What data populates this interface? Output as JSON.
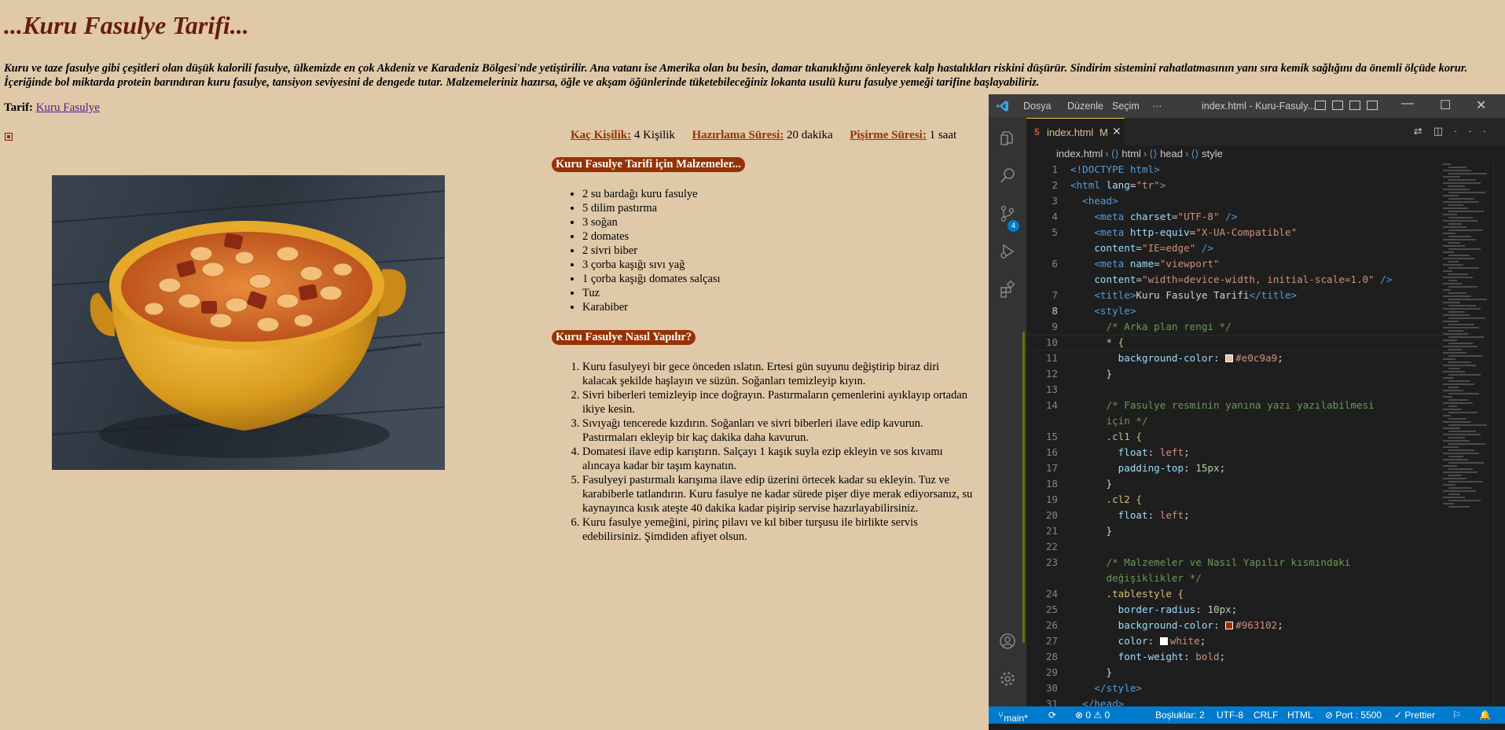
{
  "page": {
    "title": "...Kuru Fasulye Tarifi...",
    "intro": "Kuru ve taze fasulye gibi çeşitleri olan düşük kalorili fasulye, ülkemizde en çok Akdeniz ve Karadeniz Bölgesi'nde yetiştirilir. Ana vatanı ise Amerika olan bu besin, damar tıkanıklığını önleyerek kalp hastalıkları riskini düşürür. Sindirim sistemini rahatlatmasının yanı sıra kemik sağlığını da önemli ölçüde korur. İçeriğinde bol miktarda protein barındıran kuru fasulye, tansiyon seviyesini de dengede tutar. Malzemeleriniz hazırsa, öğle ve akşam öğünlerinde tüketebileceğiniz lokanta usulü kuru fasulye yemeği tarifine başlayabiliriz.",
    "recipe_label": "Tarif:",
    "recipe_link": "Kuru Fasulye",
    "servings_label": "Kaç Kişilik:",
    "servings_value": "4 Kişilik",
    "prep_label": "Hazırlama Süresi:",
    "prep_value": "20 dakika",
    "cook_label": "Pişirme Süresi:",
    "cook_value": "1 saat",
    "ingredients_title": "Kuru Fasulye Tarifi için Malzemeler...",
    "ingredients": [
      "2 su bardağı kuru fasulye",
      "5 dilim pastırma",
      "3 soğan",
      "2 domates",
      "2 sivri biber",
      "3 çorba kaşığı sıvı yağ",
      "1 çorba kaşığı domates salçası",
      "Tuz",
      "Karabiber"
    ],
    "steps_title": "Kuru Fasulye Nasıl Yapılır?",
    "steps": [
      "Kuru fasulyeyi bir gece önceden ıslatın. Ertesi gün suyunu değiştirip biraz diri kalacak şekilde haşlayın ve süzün. Soğanları temizleyip kıyın.",
      "Sivri biberleri temizleyip ince doğrayın. Pastırmaların çemenlerini ayıklayıp ortadan ikiye kesin.",
      "Sıvıyağı tencerede kızdırın. Soğanları ve sivri biberleri ilave edip kavurun. Pastırmaları ekleyip bir kaç dakika daha kavurun.",
      "Domatesi ilave edip karıştırın. Salçayı 1 kaşık suyla ezip ekleyin ve sos kıvamı alıncaya kadar bir taşım kaynatın.",
      "Fasulyeyi pastırmalı karışıma ilave edip üzerini örtecek kadar su ekleyin. Tuz ve karabiberle tatlandırın. Kuru fasulye ne kadar sürede pişer diye merak ediyorsanız, su kaynayınca kısık ateşte 40 dakika kadar pişirip servise hazırlayabilirsiniz.",
      "Kuru fasulye yemeğini, pirinç pilavı ve kıl biber turşusu ile birlikte servis edebilirsiniz. Şimdiden afiyet olsun."
    ],
    "colors": {
      "background": "#e0c9a9",
      "accent": "#963102",
      "title": "#6b1b0b"
    }
  },
  "vscode": {
    "menu": [
      "Dosya",
      "Düzenle",
      "Seçim",
      "···"
    ],
    "window_title": "index.html - Kuru-Fasuly...",
    "tab": {
      "name": "index.html",
      "modified": "M"
    },
    "breadcrumb": [
      "index.html",
      "html",
      "head",
      "style"
    ],
    "scm_badge": "4",
    "status": {
      "branch": "main*",
      "problems": "⊗ 0 ⚠ 0",
      "spaces": "Boşluklar: 2",
      "encoding": "UTF-8",
      "eol": "CRLF",
      "language": "HTML",
      "port": "⊘ Port : 5500",
      "prettier": "✓ Prettier"
    },
    "code": {
      "l1": "<!DOCTYPE html>",
      "l2a": "<html ",
      "l2b": "lang",
      "l2c": "=",
      "l2d": "\"tr\"",
      "l2e": ">",
      "l3": "<head>",
      "l4a": "<meta ",
      "l4b": "charset",
      "l4c": "\"UTF-8\"",
      "l4d": " />",
      "l5a": "<meta ",
      "l5b": "http-equiv",
      "l5c": "\"X-UA-Compatible\"",
      "l5w1": "content",
      "l5w2": "\"IE=edge\"",
      "l5w3": " />",
      "l6a": "<meta ",
      "l6b": "name",
      "l6c": "\"viewport\"",
      "l6w1": "content",
      "l6w2": "\"width=device-width, initial-scale=1.0\"",
      "l6w3": " />",
      "l7a": "<title>",
      "l7b": "Kuru Fasulye Tarifi",
      "l7c": "</title>",
      "l8": "<style>",
      "l9": "/* Arka plan rengi */",
      "l10": "* {",
      "l11a": "background-color",
      "l11b": "#e0c9a9",
      "l12": "}",
      "l14": "/* Fasulye resminin yanına yazı yazılabilmesi",
      "l14w": "için */",
      "l15": ".cl1 {",
      "l16a": "float",
      "l16b": "left",
      "l17a": "padding-top",
      "l17b": "15px",
      "l18": "}",
      "l19": ".cl2 {",
      "l20a": "float",
      "l20b": "left",
      "l21": "}",
      "l23": "/* Malzemeler ve Nasıl Yapılır kısmındaki",
      "l23w": "değişiklikler */",
      "l24": ".tablestyle {",
      "l25a": "border-radius",
      "l25b": "10px",
      "l26a": "background-color",
      "l26b": "#963102",
      "l27a": "color",
      "l27b": "white",
      "l28a": "font-weight",
      "l28b": "bold",
      "l29": "}",
      "l30": "</style>",
      "l31": "</head>"
    }
  }
}
